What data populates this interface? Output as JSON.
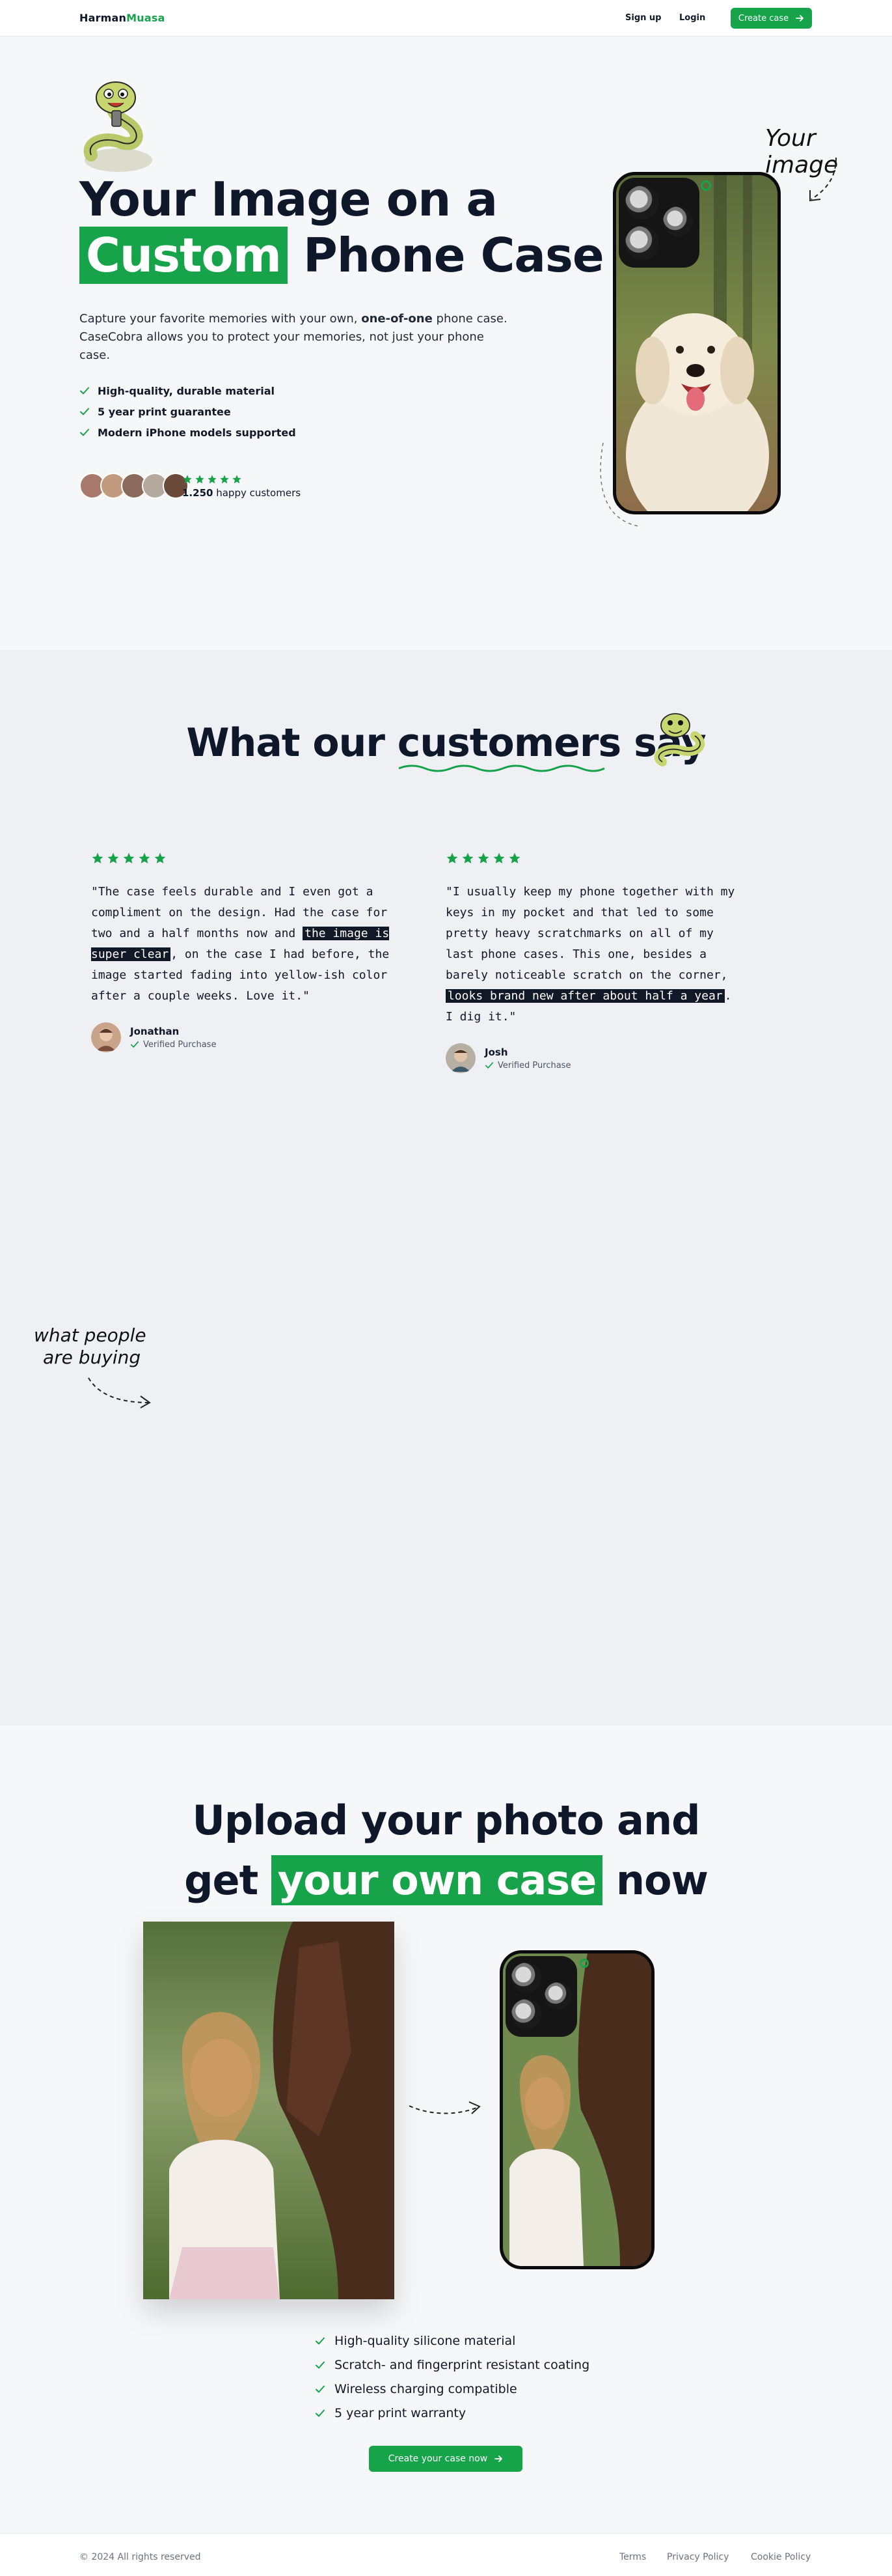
{
  "nav": {
    "logo_a": "Harman",
    "logo_b": "Muasa",
    "signup": "Sign up",
    "login": "Login",
    "create": "Create case"
  },
  "hero": {
    "title_line1": "Your Image on a",
    "title_hl": "Custom",
    "title_rest": "Phone Case",
    "sub_a": "Capture your favorite memories with your own, ",
    "sub_b": "one-of-one",
    "sub_c": " phone case. CaseCobra allows you to protect your memories, not just your phone case.",
    "features": [
      "High-quality, durable material",
      "5 year print guarantee",
      "Modern iPhone models supported"
    ],
    "customers_count": "1.250",
    "customers_label": " happy customers",
    "rating_stars": 5,
    "annotation": "Your image"
  },
  "reviews": {
    "title_a": "What our ",
    "title_b": "customers",
    "title_c": " say",
    "items": [
      {
        "text_a": "\"The case feels durable and I even got a compliment on the design. Had the case for two and a half months now and ",
        "text_mark": "the image is super clear",
        "text_c": ", on the case I had before, the image started fading into yellow-ish color after a couple weeks. Love it.\"",
        "name": "Jonathan",
        "verified": "Verified Purchase",
        "stars": 5
      },
      {
        "text_a": "\"I usually keep my phone together with my keys in my pocket and that led to some pretty heavy scratchmarks on all of my last phone cases. This one, besides a barely noticeable scratch on the corner, ",
        "text_mark": "looks brand new after about half a year",
        "text_c": ". I dig it.\"",
        "name": "Josh",
        "verified": "Verified Purchase",
        "stars": 5
      }
    ],
    "annotation_line1": "what people",
    "annotation_line2": "are buying"
  },
  "upload": {
    "title_line1": "Upload your photo and",
    "title_get": "get ",
    "title_hl": "your own case",
    "title_now": " now",
    "features": [
      "High-quality silicone material",
      "Scratch- and fingerprint resistant coating",
      "Wireless charging compatible",
      "5 year print warranty"
    ],
    "cta": "Create your case now"
  },
  "footer": {
    "copyright": "© 2024 All rights reserved",
    "links": [
      "Terms",
      "Privacy Policy",
      "Cookie Policy"
    ]
  },
  "colors": {
    "accent": "#16a34a",
    "text": "#0f172a",
    "star": "#16a34a"
  }
}
